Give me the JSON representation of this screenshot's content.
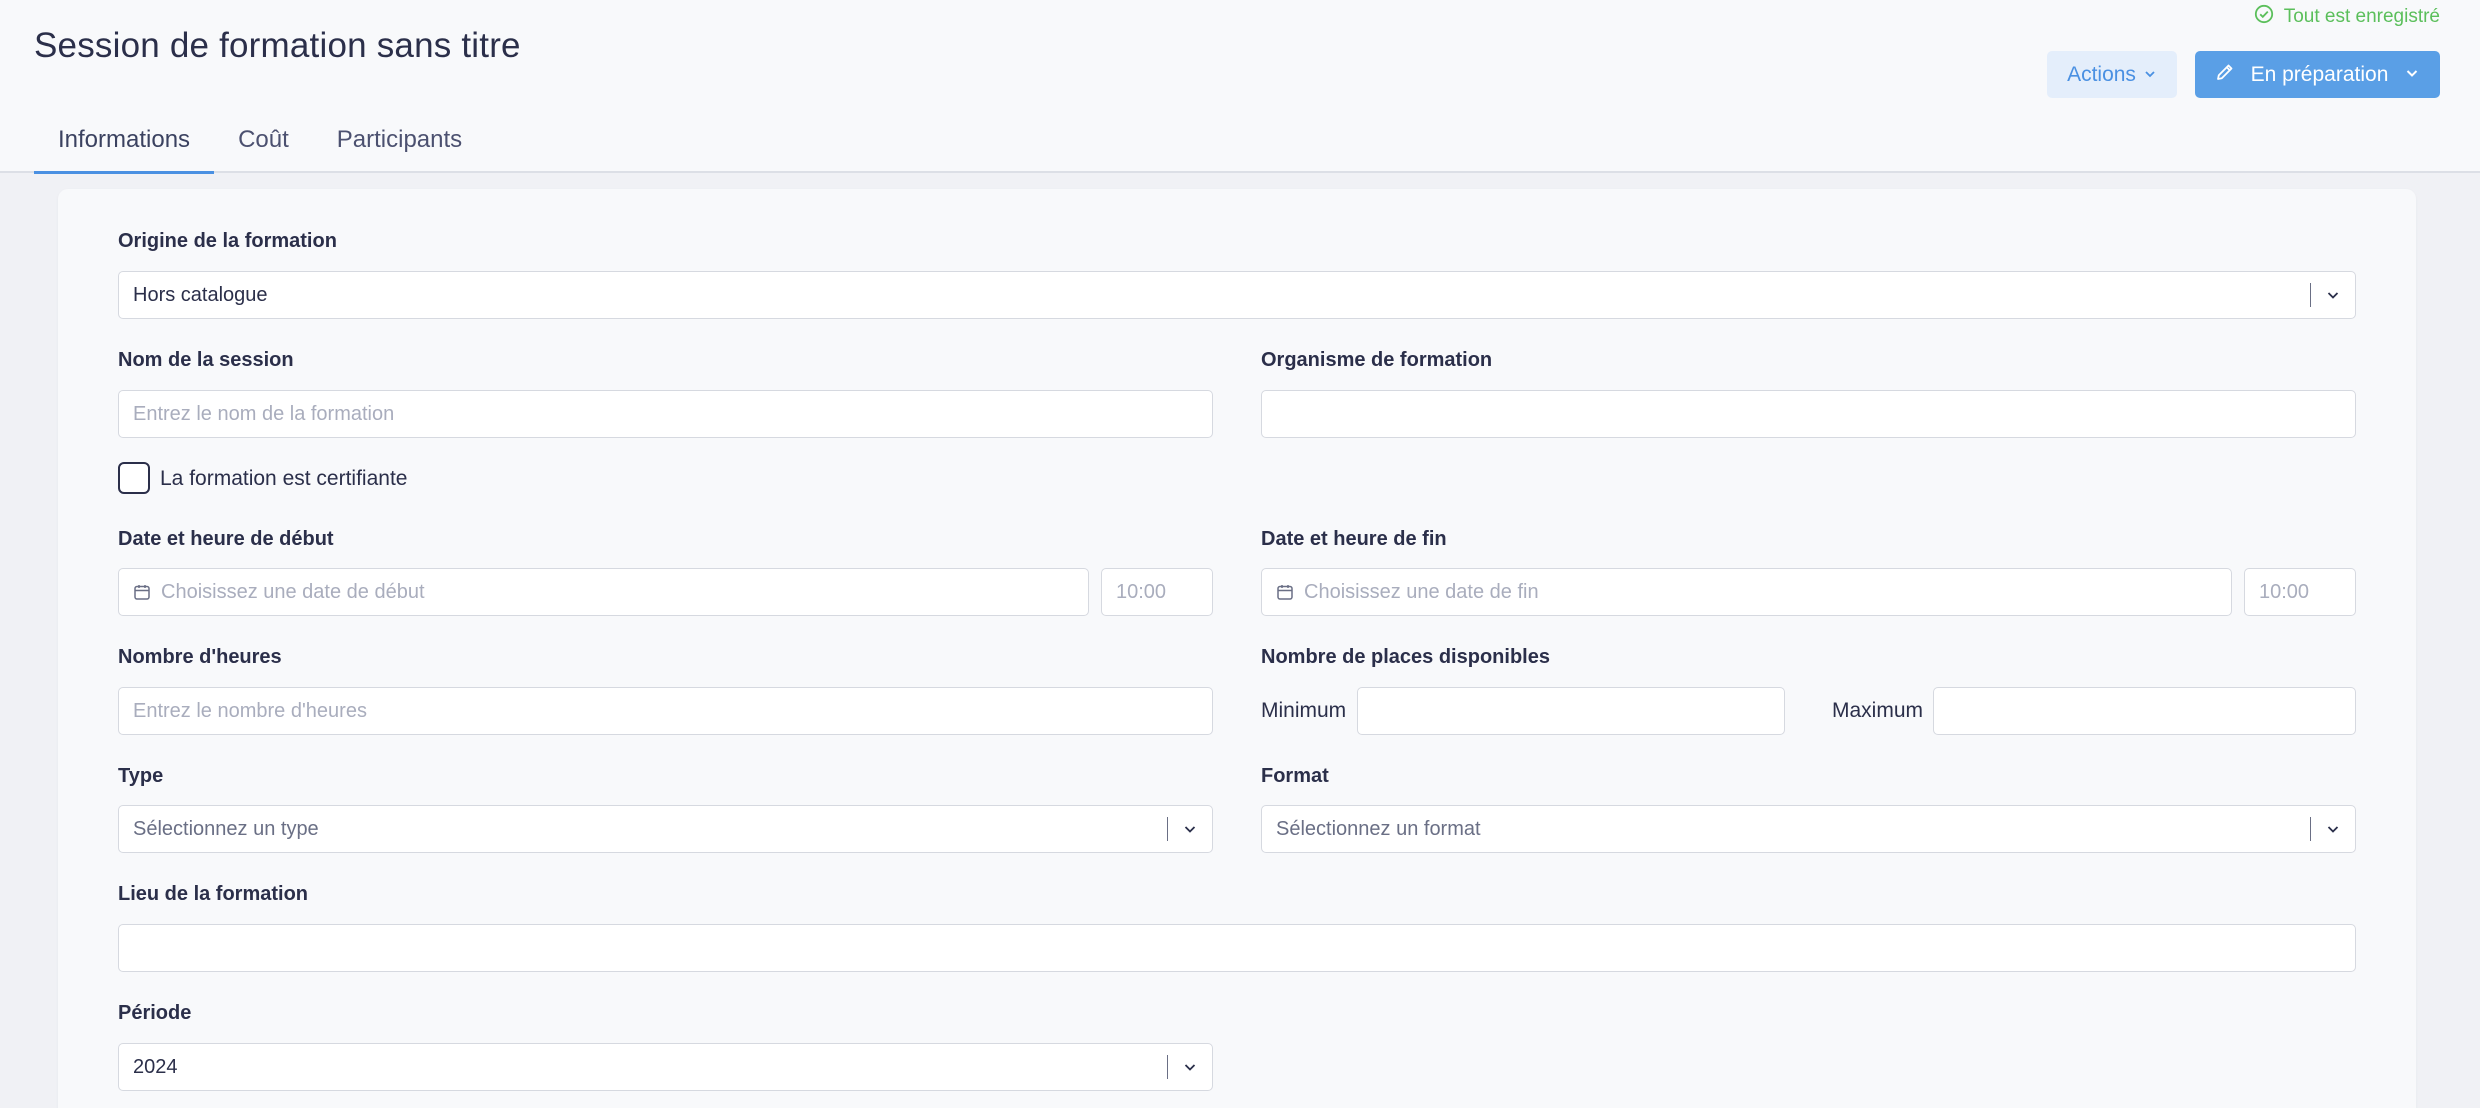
{
  "header": {
    "title": "Session de formation sans titre",
    "save_status": "Tout est enregistré",
    "actions_label": "Actions",
    "status_label": "En préparation"
  },
  "tabs": [
    {
      "label": "Informations",
      "active": true
    },
    {
      "label": "Coût",
      "active": false
    },
    {
      "label": "Participants",
      "active": false
    }
  ],
  "form": {
    "origin": {
      "label": "Origine de la formation",
      "value": "Hors catalogue"
    },
    "session_name": {
      "label": "Nom de la session",
      "placeholder": "Entrez le nom de la formation",
      "value": ""
    },
    "organism": {
      "label": "Organisme de formation",
      "value": ""
    },
    "certifying": {
      "label": "La formation est certifiante",
      "checked": false
    },
    "start": {
      "label": "Date et heure de début",
      "date_placeholder": "Choisissez une date de début",
      "time_placeholder": "10:00"
    },
    "end": {
      "label": "Date et heure de fin",
      "date_placeholder": "Choisissez une date de fin",
      "time_placeholder": "10:00"
    },
    "hours": {
      "label": "Nombre d'heures",
      "placeholder": "Entrez le nombre d'heures"
    },
    "seats": {
      "label": "Nombre de places disponibles",
      "min_label": "Minimum",
      "max_label": "Maximum"
    },
    "type": {
      "label": "Type",
      "placeholder": "Sélectionnez un type"
    },
    "format": {
      "label": "Format",
      "placeholder": "Sélectionnez un format"
    },
    "location": {
      "label": "Lieu de la formation",
      "value": ""
    },
    "period": {
      "label": "Période",
      "value": "2024"
    }
  },
  "colors": {
    "accent": "#4a90e2",
    "primary_button": "#5a9fe6",
    "success": "#5bbf5b",
    "text": "#2b2f4a"
  },
  "icons": [
    "check-circle-icon",
    "chevron-down-icon",
    "pencil-icon",
    "calendar-icon"
  ]
}
